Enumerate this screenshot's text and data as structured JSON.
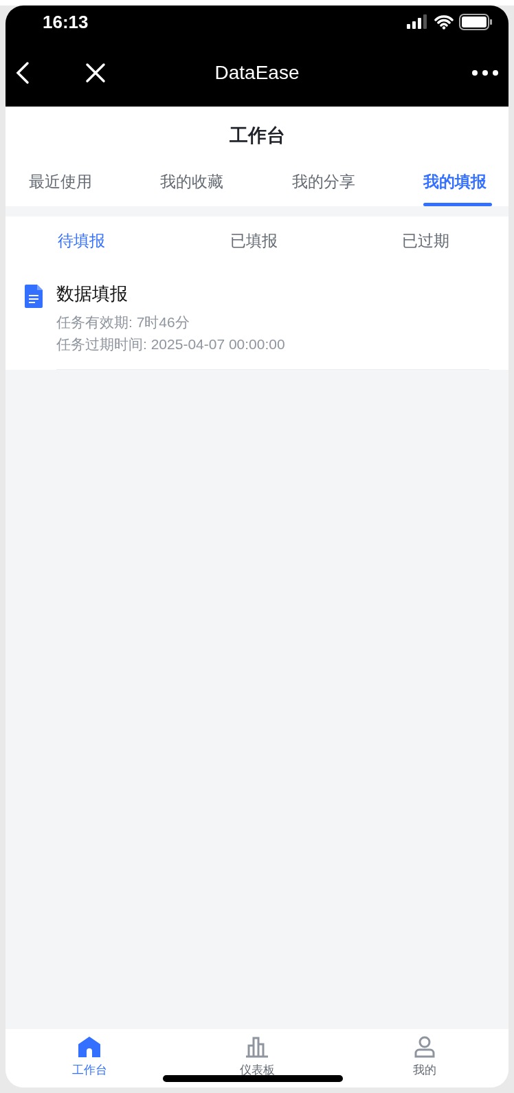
{
  "status_bar": {
    "time": "16:13"
  },
  "nav_bar": {
    "title": "DataEase"
  },
  "page_title": "工作台",
  "tabs": [
    {
      "label": "最近使用",
      "selected": false
    },
    {
      "label": "我的收藏",
      "selected": false
    },
    {
      "label": "我的分享",
      "selected": false
    },
    {
      "label": "我的填报",
      "selected": true
    }
  ],
  "sub_tabs": [
    {
      "label": "待填报",
      "selected": true
    },
    {
      "label": "已填报",
      "selected": false
    },
    {
      "label": "已过期",
      "selected": false
    }
  ],
  "tasks": [
    {
      "title": "数据填报",
      "validity": "任务有效期: 7时46分",
      "expiry": "任务过期时间: 2025-04-07 00:00:00"
    }
  ],
  "bottom_nav": [
    {
      "label": "工作台",
      "kind": "home",
      "selected": true
    },
    {
      "label": "仪表板",
      "kind": "chart",
      "selected": false
    },
    {
      "label": "我的",
      "kind": "user",
      "selected": false
    }
  ]
}
